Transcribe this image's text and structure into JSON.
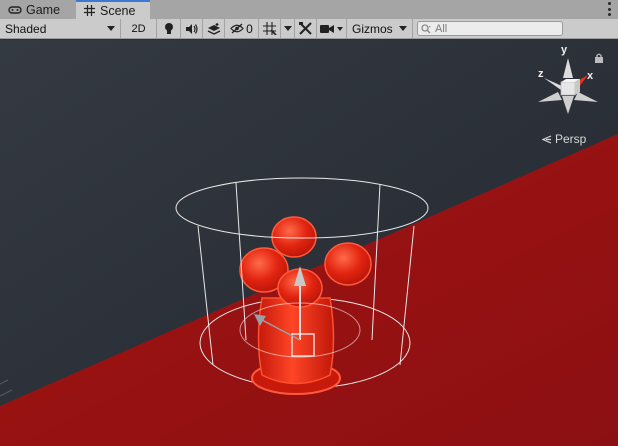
{
  "tabs": [
    {
      "label": "Game",
      "icon": "gamepad-icon",
      "active": false
    },
    {
      "label": "Scene",
      "icon": "grid-icon",
      "active": true
    }
  ],
  "toolbar": {
    "draw_mode": "Shaded",
    "mode_2d": "2D",
    "hidden_count": "0",
    "gizmos_label": "Gizmos",
    "search_placeholder": "All"
  },
  "orientation_gizmo": {
    "x_label": "x",
    "y_label": "y",
    "z_label": "z",
    "projection_label": "Persp"
  },
  "colors": {
    "tab_bar": "#a5a5a5",
    "toolbar": "#cbcbcb",
    "active_tab_accent": "#3a79d6",
    "sky": "#2b2f36",
    "ground": "#9c1414",
    "object": "#e0200d",
    "x_axis": "#e8301e"
  }
}
